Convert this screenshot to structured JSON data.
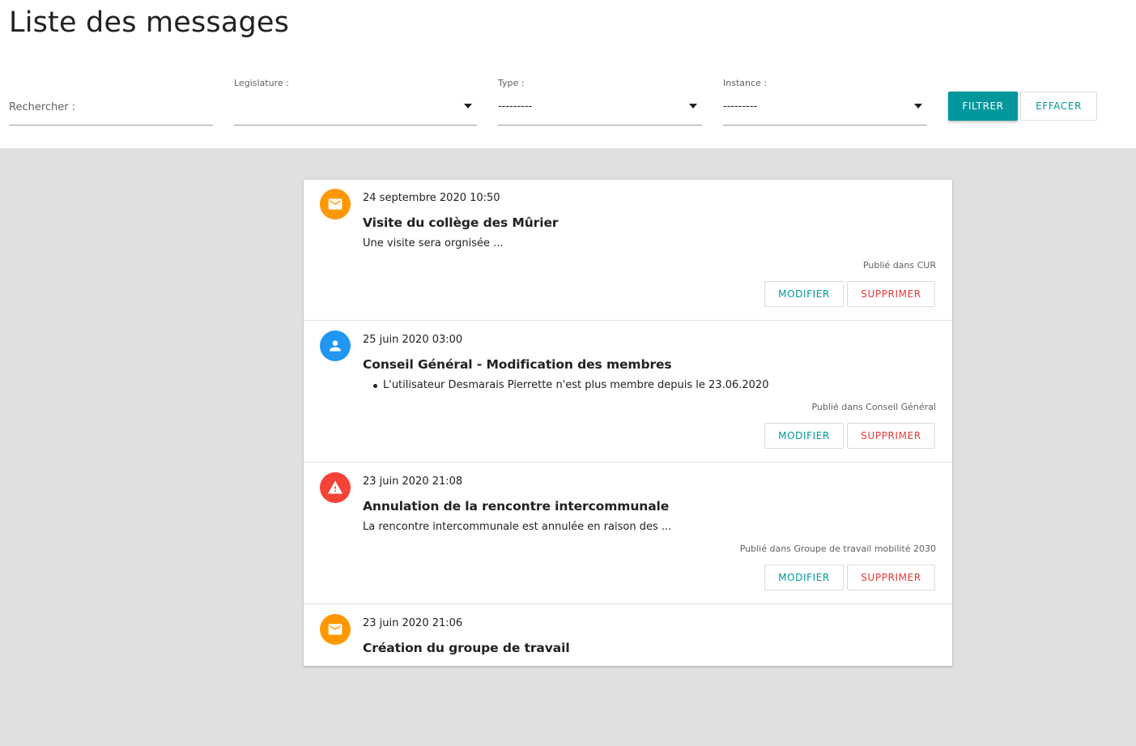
{
  "page": {
    "title": "Liste des messages"
  },
  "filters": {
    "search_label": "Rechercher :",
    "legislature_label": "Legislature :",
    "legislature_value": "",
    "type_label": "Type :",
    "type_value": "---------",
    "instance_label": "Instance :",
    "instance_value": "---------",
    "filter_button": "FILTRER",
    "clear_button": "EFFACER"
  },
  "colors": {
    "accent": "#00979d",
    "danger": "#e53935",
    "mail_icon_bg": "#ff9800",
    "user_icon_bg": "#2196f3",
    "warning_icon_bg": "#f44336"
  },
  "messages": [
    {
      "icon": "mail-icon",
      "date": "24 septembre 2020 10:50",
      "title": "Visite du collège des Mûrier",
      "body": "Une visite sera orgnisée ...",
      "published": "Publié dans CUR",
      "edit_label": "MODIFIER",
      "delete_label": "SUPPRIMER"
    },
    {
      "icon": "person-icon",
      "date": "25 juin 2020 03:00",
      "title": "Conseil Général - Modification des membres",
      "bullet": "L'utilisateur Desmarais Pierrette n'est plus membre depuis le 23.06.2020",
      "published": "Publié dans Conseil Général",
      "edit_label": "MODIFIER",
      "delete_label": "SUPPRIMER"
    },
    {
      "icon": "warning-icon",
      "date": "23 juin 2020 21:08",
      "title": "Annulation de la rencontre intercommunale",
      "body": "La rencontre intercommunale est annulée en raison des ...",
      "published": "Publié dans Groupe de travail mobilité 2030",
      "edit_label": "MODIFIER",
      "delete_label": "SUPPRIMER"
    },
    {
      "icon": "mail-icon",
      "date": "23 juin 2020 21:06",
      "title": "Création du groupe de travail"
    }
  ]
}
